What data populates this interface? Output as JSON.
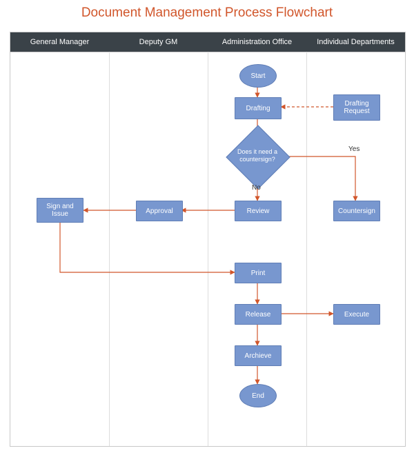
{
  "title": "Document Management Process Flowchart",
  "lanes": [
    "General Manager",
    "Deputy GM",
    "Administration Office",
    "Individual Departments"
  ],
  "nodes": {
    "start": "Start",
    "drafting": "Drafting",
    "draft_req": "Drafting Request",
    "decision": "Does it need a countersign?",
    "review": "Review",
    "approval": "Approval",
    "sign_issue": "Sign and Issue",
    "countersign": "Countersign",
    "print": "Print",
    "release": "Release",
    "execute": "Execute",
    "archive": "Archieve",
    "end": "End"
  },
  "branches": {
    "yes": "Yes",
    "no": "No"
  },
  "chart_data": {
    "type": "flowchart-swimlane",
    "title": "Document Management Process Flowchart",
    "lanes": [
      "General Manager",
      "Deputy GM",
      "Administration Office",
      "Individual Departments"
    ],
    "shapes": [
      {
        "id": "start",
        "type": "terminator",
        "lane": "Administration Office",
        "label": "Start"
      },
      {
        "id": "drafting",
        "type": "process",
        "lane": "Administration Office",
        "label": "Drafting"
      },
      {
        "id": "draft_req",
        "type": "process",
        "lane": "Individual Departments",
        "label": "Drafting Request"
      },
      {
        "id": "decision",
        "type": "decision",
        "lane": "Administration Office",
        "label": "Does it need a countersign?"
      },
      {
        "id": "review",
        "type": "process",
        "lane": "Administration Office",
        "label": "Review"
      },
      {
        "id": "approval",
        "type": "process",
        "lane": "Deputy GM",
        "label": "Approval"
      },
      {
        "id": "sign_issue",
        "type": "process",
        "lane": "General Manager",
        "label": "Sign and Issue"
      },
      {
        "id": "countersign",
        "type": "process",
        "lane": "Individual Departments",
        "label": "Countersign"
      },
      {
        "id": "print",
        "type": "process",
        "lane": "Administration Office",
        "label": "Print"
      },
      {
        "id": "release",
        "type": "process",
        "lane": "Administration Office",
        "label": "Release"
      },
      {
        "id": "execute",
        "type": "process",
        "lane": "Individual Departments",
        "label": "Execute"
      },
      {
        "id": "archive",
        "type": "process",
        "lane": "Administration Office",
        "label": "Archieve"
      },
      {
        "id": "end",
        "type": "terminator",
        "lane": "Administration Office",
        "label": "End"
      }
    ],
    "edges": [
      {
        "from": "start",
        "to": "drafting"
      },
      {
        "from": "draft_req",
        "to": "drafting",
        "style": "dashed"
      },
      {
        "from": "drafting",
        "to": "decision"
      },
      {
        "from": "decision",
        "to": "review",
        "label": "No"
      },
      {
        "from": "decision",
        "to": "countersign",
        "label": "Yes"
      },
      {
        "from": "review",
        "to": "approval"
      },
      {
        "from": "approval",
        "to": "sign_issue"
      },
      {
        "from": "sign_issue",
        "to": "print"
      },
      {
        "from": "print",
        "to": "release"
      },
      {
        "from": "release",
        "to": "execute"
      },
      {
        "from": "release",
        "to": "archive"
      },
      {
        "from": "archive",
        "to": "end"
      }
    ]
  }
}
